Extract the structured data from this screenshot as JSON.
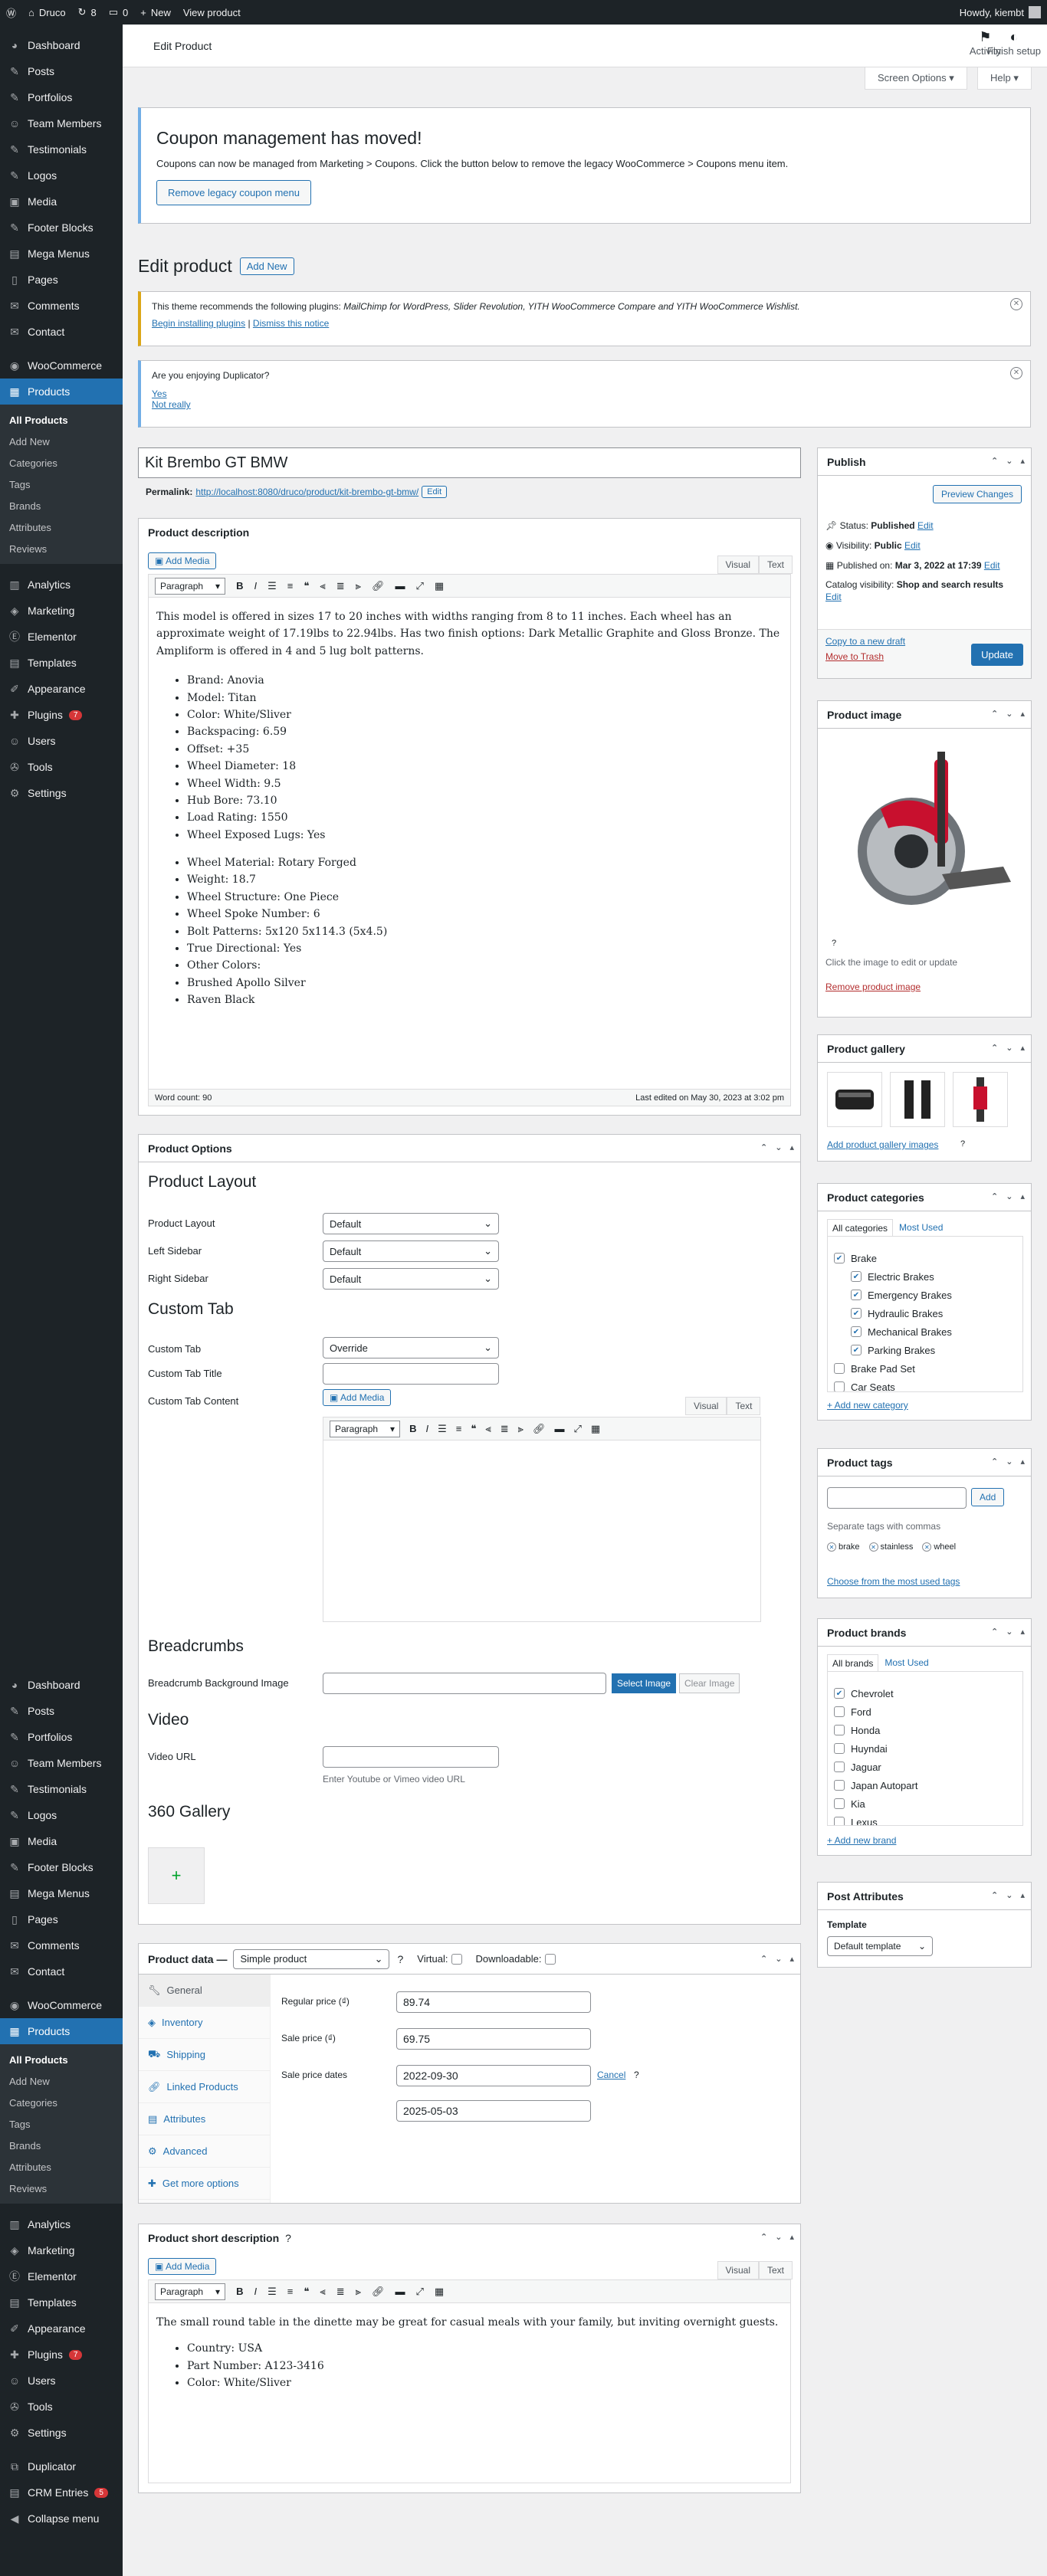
{
  "adminbar": {
    "site": "Druco",
    "updates": "8",
    "comments": "0",
    "new": "New",
    "view": "View product",
    "howdy": "Howdy, kiembt"
  },
  "sidebar": {
    "top": [
      "Dashboard",
      "Posts",
      "Portfolios",
      "Team Members",
      "Testimonials",
      "Logos",
      "Media",
      "Footer Blocks",
      "Mega Menus",
      "Pages",
      "Comments",
      "Contact"
    ],
    "woo": [
      "WooCommerce",
      "Products"
    ],
    "sub": [
      "All Products",
      "Add New",
      "Categories",
      "Tags",
      "Brands",
      "Attributes",
      "Reviews"
    ],
    "bottom": [
      "Analytics",
      "Marketing",
      "Elementor",
      "Templates",
      "Appearance",
      "Plugins",
      "Users",
      "Tools",
      "Settings"
    ],
    "plugins_badge": "7",
    "extra": [
      "Duplicator",
      "CRM Entries",
      "Collapse menu"
    ],
    "crm_badge": "5"
  },
  "header": {
    "title": "Edit Product",
    "activity": "Activity",
    "finish": "Finish setup",
    "screen_options": "Screen Options ▾",
    "help": "Help ▾"
  },
  "coupon": {
    "title": "Coupon management has moved!",
    "text": "Coupons can now be managed from Marketing > Coupons. Click the button below to remove the legacy WooCommerce > Coupons menu item.",
    "button": "Remove legacy coupon menu"
  },
  "page": {
    "heading": "Edit product",
    "add_new": "Add New"
  },
  "theme_notice": {
    "prefix": "This theme recommends the following plugins: ",
    "plugins": "MailChimp for WordPress, Slider Revolution, YITH WooCommerce Compare and YITH WooCommerce Wishlist.",
    "begin": "Begin installing plugins",
    "sep": "|",
    "dismiss": "Dismiss this notice"
  },
  "dup_notice": {
    "q": "Are you enjoying Duplicator?",
    "yes": "Yes",
    "no": "Not really"
  },
  "title_field": "Kit Brembo GT BMW",
  "permalink": {
    "label": "Permalink:",
    "url": "http://localhost:8080/druco/product/kit-brembo-gt-bmw/",
    "edit": "Edit"
  },
  "desc": {
    "title": "Product description",
    "add_media": "Add Media",
    "visual": "Visual",
    "text": "Text",
    "paragraph": "Paragraph",
    "intro": "This model is offered in sizes 17 to 20 inches with widths ranging from 8 to 11 inches. Each wheel has an approximate weight of 17.19lbs to 22.94lbs. Has two finish options: Dark Metallic Graphite and Gloss Bronze. The Ampliform is offered in 4 and 5 lug bolt patterns.",
    "list1": [
      "Brand: Anovia",
      "Model: Titan",
      "Color: White/Sliver",
      "Backspacing: 6.59",
      "Offset: +35",
      "Wheel Diameter: 18",
      "Wheel Width: 9.5",
      "Hub Bore: 73.10",
      "Load Rating: 1550",
      "Wheel Exposed Lugs: Yes"
    ],
    "list2": [
      "Wheel Material: Rotary Forged",
      "Weight: 18.7",
      "Wheel Structure: One Piece",
      "Wheel Spoke Number: 6",
      "Bolt Patterns: 5x120 5x114.3 (5x4.5)",
      "True Directional: Yes",
      "Other Colors:",
      "Brushed Apollo Silver",
      "Raven Black"
    ],
    "word_count": "Word count: 90",
    "last_edited": "Last edited on May 30, 2023 at 3:02 pm"
  },
  "options": {
    "title": "Product Options",
    "layout_h": "Product Layout",
    "fields": [
      {
        "label": "Product Layout",
        "value": "Default"
      },
      {
        "label": "Left Sidebar",
        "value": "Default"
      },
      {
        "label": "Right Sidebar",
        "value": "Default"
      }
    ],
    "custom_h": "Custom Tab",
    "custom_tab": {
      "label": "Custom Tab",
      "value": "Override"
    },
    "custom_title": "Custom Tab Title",
    "custom_content": "Custom Tab Content",
    "bc_h": "Breadcrumbs",
    "bc_label": "Breadcrumb Background Image",
    "select_image": "Select Image",
    "clear_image": "Clear Image",
    "video_h": "Video",
    "video_label": "Video URL",
    "video_hint": "Enter Youtube or Vimeo video URL",
    "gallery_h": "360 Gallery",
    "plus": "+"
  },
  "pdata": {
    "title": "Product data —",
    "type": "Simple product",
    "virtual": "Virtual:",
    "downloadable": "Downloadable:",
    "tabs": [
      "General",
      "Inventory",
      "Shipping",
      "Linked Products",
      "Attributes",
      "Advanced",
      "Get more options"
    ],
    "regular_label": "Regular price (₫)",
    "regular": "89.74",
    "sale_label": "Sale price (₫)",
    "sale": "69.75",
    "dates_label": "Sale price dates",
    "from": "2022-09-30",
    "to": "2025-05-03",
    "cancel": "Cancel"
  },
  "short": {
    "title": "Product short description",
    "add_media": "Add Media",
    "visual": "Visual",
    "text": "Text",
    "paragraph": "Paragraph",
    "intro": "The small round table in the dinette may be great for casual meals with your family, but inviting overnight guests.",
    "list": [
      "Country: USA",
      "Part Number: A123-3416",
      "Color: White/Sliver"
    ]
  },
  "publish": {
    "title": "Publish",
    "preview": "Preview Changes",
    "status": "Status: ",
    "status_v": "Published",
    "visibility": "Visibility: ",
    "visibility_v": "Public",
    "published": "Published on: ",
    "published_v": "Mar 3, 2022 at 17:39",
    "edit": "Edit",
    "catalog": "Catalog visibility: ",
    "catalog_v": "Shop and search results",
    "copy": "Copy to a new draft",
    "trash": "Move to Trash",
    "update": "Update"
  },
  "pimage": {
    "title": "Product image",
    "hint": "Click the image to edit or update",
    "remove": "Remove product image"
  },
  "gallery": {
    "title": "Product gallery",
    "add": "Add product gallery images"
  },
  "cats": {
    "title": "Product categories",
    "all": "All categories",
    "most": "Most Used",
    "items": [
      {
        "name": "Brake",
        "checked": true,
        "indent": 0
      },
      {
        "name": "Electric Brakes",
        "checked": true,
        "indent": 1
      },
      {
        "name": "Emergency Brakes",
        "checked": true,
        "indent": 1
      },
      {
        "name": "Hydraulic Brakes",
        "checked": true,
        "indent": 1
      },
      {
        "name": "Mechanical Brakes",
        "checked": true,
        "indent": 1
      },
      {
        "name": "Parking Brakes",
        "checked": true,
        "indent": 1
      },
      {
        "name": "Brake Pad Set",
        "checked": false,
        "indent": 0
      },
      {
        "name": "Car Seats",
        "checked": false,
        "indent": 0
      }
    ],
    "add": "+ Add new category"
  },
  "tags": {
    "title": "Product tags",
    "add": "Add",
    "hint": "Separate tags with commas",
    "items": [
      "brake",
      "stainless",
      "wheel"
    ],
    "choose": "Choose from the most used tags"
  },
  "brands": {
    "title": "Product brands",
    "all": "All brands",
    "most": "Most Used",
    "items": [
      {
        "name": "Chevrolet",
        "checked": true
      },
      {
        "name": "Ford",
        "checked": false
      },
      {
        "name": "Honda",
        "checked": false
      },
      {
        "name": "Huyndai",
        "checked": false
      },
      {
        "name": "Jaguar",
        "checked": false
      },
      {
        "name": "Japan Autopart",
        "checked": false
      },
      {
        "name": "Kia",
        "checked": false
      },
      {
        "name": "Lexus",
        "checked": false
      }
    ],
    "add": "+ Add new brand"
  },
  "attrs": {
    "title": "Post Attributes",
    "template": "Template",
    "value": "Default template"
  }
}
